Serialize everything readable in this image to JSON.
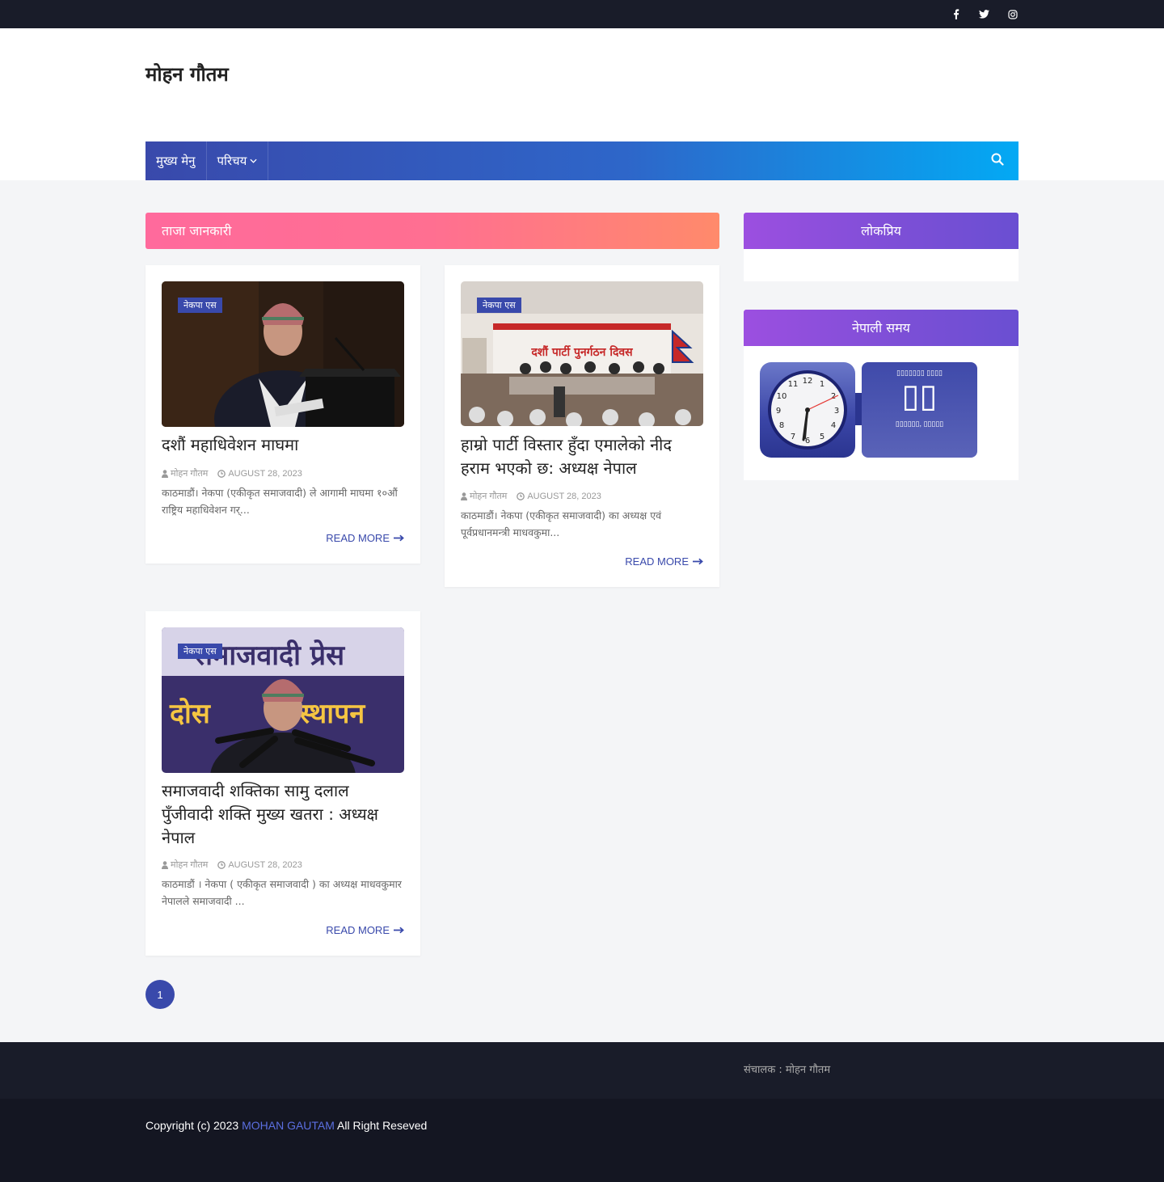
{
  "social": [
    "facebook-icon",
    "twitter-icon",
    "instagram-icon"
  ],
  "site": {
    "title": "मोहन गौतम"
  },
  "nav": {
    "items": [
      {
        "label": "मुख्य मेनु"
      },
      {
        "label": "परिचय"
      }
    ],
    "search_icon": "search-icon"
  },
  "section_title": "ताजा जानकारी",
  "posts": [
    {
      "category": "नेकपा एस",
      "title": "दशौं महाधिवेशन माघमा",
      "author": "मोहन गौतम",
      "date": "August 28, 2023",
      "excerpt": "काठमाडौं। नेकपा (एकीकृत समाजवादी) ले आगामी माघमा १०औं राष्ट्रिय महाधिवेशन गर्...",
      "read_more": "READ MORE"
    },
    {
      "category": "नेकपा एस",
      "title": "हाम्रो पार्टी विस्तार हुँदा एमालेको नीद हराम भएको छ: अध्यक्ष नेपाल",
      "author": "मोहन गौतम",
      "date": "August 28, 2023",
      "excerpt": "काठमाडौं। नेकपा (एकीकृत समाजवादी) का अध्यक्ष एवं पूर्वप्रधानमन्त्री माधवकुमा...",
      "read_more": "READ MORE"
    },
    {
      "category": "नेकपा एस",
      "title": "समाजवादी शक्तिका सामु दलाल पुँजीवादी शक्ति मुख्य खतरा : अध्यक्ष नेपाल",
      "author": "मोहन गौतम",
      "date": "August 28, 2023",
      "excerpt": "काठमाडौं । नेकपा ( एकीकृत समाजवादी ) का अध्यक्ष माधवकुमार नेपालले समाजवादी ...",
      "read_more": "READ MORE"
    }
  ],
  "pagination": {
    "current": "1"
  },
  "sidebar": {
    "popular_title": "लोकप्रिय",
    "time_title": "नेपाली समय",
    "clock_numbers": [
      "12",
      "1",
      "2",
      "3",
      "4",
      "5",
      "6",
      "7",
      "8",
      "9",
      "10",
      "11"
    ],
    "date_top": "▯▯▯▯▯▯▯ ▯▯▯▯",
    "date_day": "▯▯",
    "date_bottom": "▯▯▯▯▯▯, ▯▯▯▯▯"
  },
  "footer": {
    "operator": "संचालक : मोहन गौतम",
    "copyright_prefix": "Copyright (c) 2023",
    "brand": "MOHAN GAUTAM",
    "copyright_suffix": "All Right Reseved"
  },
  "colors": {
    "accent": "#3949ab",
    "dark": "#191c29",
    "section_pink": "#ff6f91",
    "widget_purple": "#8a4fdb"
  }
}
